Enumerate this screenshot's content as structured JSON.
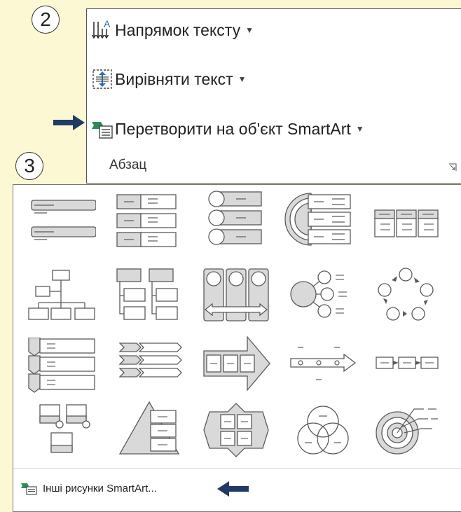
{
  "badges": {
    "step2": "2",
    "step3": "3"
  },
  "ribbon": {
    "text_direction": "Напрямок тексту",
    "align_text": "Вирівняти текст",
    "convert_smartart": "Перетворити на об'єкт SmartArt",
    "group_label": "Абзац",
    "dropdown_glyph": "▼"
  },
  "gallery": {
    "more_link": "Інші рисунки SmartArt..."
  },
  "colors": {
    "accent": "#1f3b63",
    "smartart_green": "#2e8b57",
    "icon_blue": "#2b6cb0",
    "thumb_fill": "#d9d9d9",
    "thumb_stroke": "#5a5a5a"
  },
  "icons": [
    "text-direction-icon",
    "align-text-icon",
    "smartart-icon",
    "dialog-launcher-icon",
    "arrow-right-icon",
    "arrow-left-icon"
  ]
}
